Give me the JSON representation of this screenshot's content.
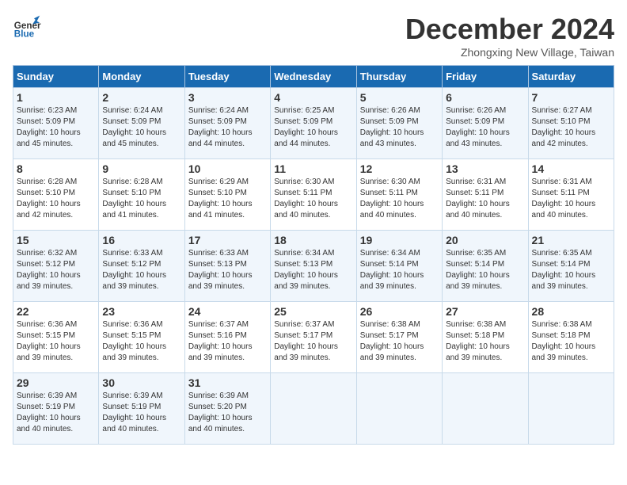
{
  "logo": {
    "line1": "General",
    "line2": "Blue"
  },
  "title": "December 2024",
  "location": "Zhongxing New Village, Taiwan",
  "days_of_week": [
    "Sunday",
    "Monday",
    "Tuesday",
    "Wednesday",
    "Thursday",
    "Friday",
    "Saturday"
  ],
  "weeks": [
    [
      {
        "day": 1,
        "sunrise": "6:23 AM",
        "sunset": "5:09 PM",
        "daylight": "10 hours and 45 minutes."
      },
      {
        "day": 2,
        "sunrise": "6:24 AM",
        "sunset": "5:09 PM",
        "daylight": "10 hours and 45 minutes."
      },
      {
        "day": 3,
        "sunrise": "6:24 AM",
        "sunset": "5:09 PM",
        "daylight": "10 hours and 44 minutes."
      },
      {
        "day": 4,
        "sunrise": "6:25 AM",
        "sunset": "5:09 PM",
        "daylight": "10 hours and 44 minutes."
      },
      {
        "day": 5,
        "sunrise": "6:26 AM",
        "sunset": "5:09 PM",
        "daylight": "10 hours and 43 minutes."
      },
      {
        "day": 6,
        "sunrise": "6:26 AM",
        "sunset": "5:09 PM",
        "daylight": "10 hours and 43 minutes."
      },
      {
        "day": 7,
        "sunrise": "6:27 AM",
        "sunset": "5:10 PM",
        "daylight": "10 hours and 42 minutes."
      }
    ],
    [
      {
        "day": 8,
        "sunrise": "6:28 AM",
        "sunset": "5:10 PM",
        "daylight": "10 hours and 42 minutes."
      },
      {
        "day": 9,
        "sunrise": "6:28 AM",
        "sunset": "5:10 PM",
        "daylight": "10 hours and 41 minutes."
      },
      {
        "day": 10,
        "sunrise": "6:29 AM",
        "sunset": "5:10 PM",
        "daylight": "10 hours and 41 minutes."
      },
      {
        "day": 11,
        "sunrise": "6:30 AM",
        "sunset": "5:11 PM",
        "daylight": "10 hours and 40 minutes."
      },
      {
        "day": 12,
        "sunrise": "6:30 AM",
        "sunset": "5:11 PM",
        "daylight": "10 hours and 40 minutes."
      },
      {
        "day": 13,
        "sunrise": "6:31 AM",
        "sunset": "5:11 PM",
        "daylight": "10 hours and 40 minutes."
      },
      {
        "day": 14,
        "sunrise": "6:31 AM",
        "sunset": "5:11 PM",
        "daylight": "10 hours and 40 minutes."
      }
    ],
    [
      {
        "day": 15,
        "sunrise": "6:32 AM",
        "sunset": "5:12 PM",
        "daylight": "10 hours and 39 minutes."
      },
      {
        "day": 16,
        "sunrise": "6:33 AM",
        "sunset": "5:12 PM",
        "daylight": "10 hours and 39 minutes."
      },
      {
        "day": 17,
        "sunrise": "6:33 AM",
        "sunset": "5:13 PM",
        "daylight": "10 hours and 39 minutes."
      },
      {
        "day": 18,
        "sunrise": "6:34 AM",
        "sunset": "5:13 PM",
        "daylight": "10 hours and 39 minutes."
      },
      {
        "day": 19,
        "sunrise": "6:34 AM",
        "sunset": "5:14 PM",
        "daylight": "10 hours and 39 minutes."
      },
      {
        "day": 20,
        "sunrise": "6:35 AM",
        "sunset": "5:14 PM",
        "daylight": "10 hours and 39 minutes."
      },
      {
        "day": 21,
        "sunrise": "6:35 AM",
        "sunset": "5:14 PM",
        "daylight": "10 hours and 39 minutes."
      }
    ],
    [
      {
        "day": 22,
        "sunrise": "6:36 AM",
        "sunset": "5:15 PM",
        "daylight": "10 hours and 39 minutes."
      },
      {
        "day": 23,
        "sunrise": "6:36 AM",
        "sunset": "5:15 PM",
        "daylight": "10 hours and 39 minutes."
      },
      {
        "day": 24,
        "sunrise": "6:37 AM",
        "sunset": "5:16 PM",
        "daylight": "10 hours and 39 minutes."
      },
      {
        "day": 25,
        "sunrise": "6:37 AM",
        "sunset": "5:17 PM",
        "daylight": "10 hours and 39 minutes."
      },
      {
        "day": 26,
        "sunrise": "6:38 AM",
        "sunset": "5:17 PM",
        "daylight": "10 hours and 39 minutes."
      },
      {
        "day": 27,
        "sunrise": "6:38 AM",
        "sunset": "5:18 PM",
        "daylight": "10 hours and 39 minutes."
      },
      {
        "day": 28,
        "sunrise": "6:38 AM",
        "sunset": "5:18 PM",
        "daylight": "10 hours and 39 minutes."
      }
    ],
    [
      {
        "day": 29,
        "sunrise": "6:39 AM",
        "sunset": "5:19 PM",
        "daylight": "10 hours and 40 minutes."
      },
      {
        "day": 30,
        "sunrise": "6:39 AM",
        "sunset": "5:19 PM",
        "daylight": "10 hours and 40 minutes."
      },
      {
        "day": 31,
        "sunrise": "6:39 AM",
        "sunset": "5:20 PM",
        "daylight": "10 hours and 40 minutes."
      },
      null,
      null,
      null,
      null
    ]
  ],
  "labels": {
    "sunrise": "Sunrise: ",
    "sunset": "Sunset: ",
    "daylight": "Daylight: "
  }
}
